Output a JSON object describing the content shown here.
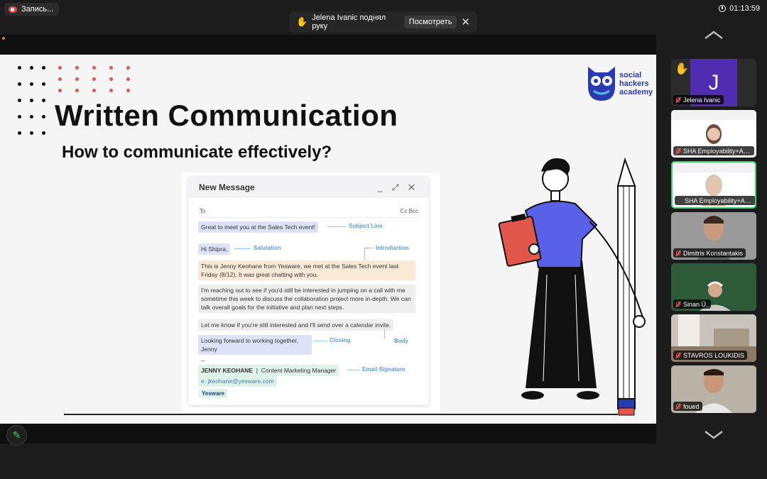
{
  "recording": {
    "label": "Запись..."
  },
  "timer": {
    "value": "01:13:59"
  },
  "notification": {
    "text": "Jelena Ivanic поднял руку",
    "view_label": "Посмотреть",
    "hand_icon": "✋",
    "close_icon": "✕"
  },
  "slide": {
    "title": "Written Communication",
    "subtitle": "How to communicate effectively?",
    "logo": {
      "line1": "social",
      "line2": "hackers",
      "line3": "academy"
    },
    "email": {
      "header": "New Message",
      "controls": "_ ⤢ ✕",
      "to_label": "To",
      "cc_bcc": "Cc  Bcc",
      "subject": "Great to meet you at the Sales Tech event!",
      "salutation": "Hi Shipra,",
      "intro": "This is Jenny Keohane from Yesware, we met at the Sales Tech event last Friday (8/12). It was great chatting with you.",
      "body1": "I'm reaching out to see if you'd still be interested in jumping on a call with me sometime this week to discuss the collaboration project more in-depth. We can talk overall goals for the initiative and plan next steps.",
      "body2": "Let me know if you're still interested and I'll send over a calendar invite.",
      "closing1": "Looking forward to working together,",
      "closing2": "Jenny",
      "ellipsis": "--",
      "sig_name": "JENNY KEOHANE",
      "sig_role": "Content Marketing Manager",
      "sig_email": "e: jkeohane@yesware.com",
      "sig_brand": "Yesware",
      "tags": {
        "subject": "Subject Line",
        "salutation": "Salutation",
        "intro": "Introduction",
        "closing": "Closing",
        "body": "Body",
        "signature": "Email Signature"
      }
    }
  },
  "participants": [
    {
      "name": "Jelena Ivanic",
      "initial": "J",
      "hand": "✋"
    },
    {
      "name": "SHA Employability+Adm..."
    },
    {
      "name": "SHA Employability+Adm..."
    },
    {
      "name": "Dimitris Konstantakis"
    },
    {
      "name": "Sinan Ü."
    },
    {
      "name": "STAVROS LOUKIDIS"
    },
    {
      "name": "foued"
    }
  ],
  "colors": {
    "accent_green": "#3fd06c",
    "logo_blue": "#2a3bb0",
    "tag_blue": "#5e9bd8"
  }
}
